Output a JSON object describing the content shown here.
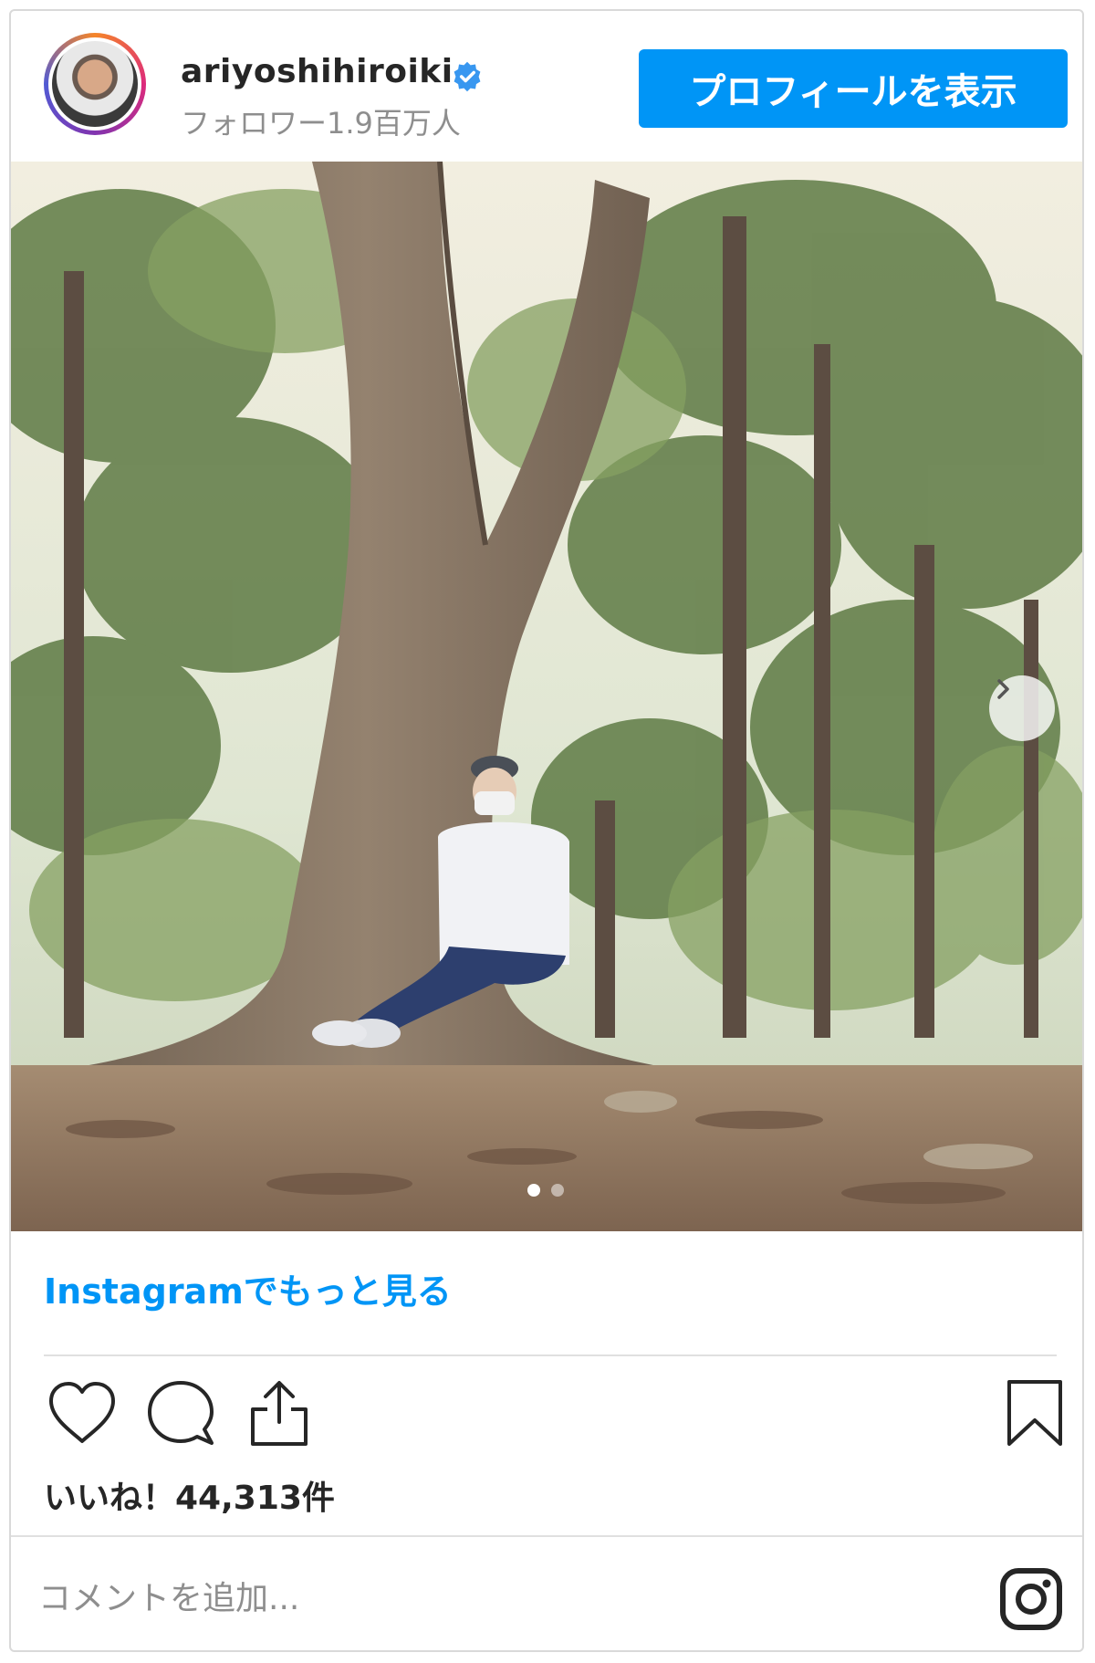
{
  "header": {
    "username": "ariyoshihiroiki",
    "followers": "フォロワー1.9百万人",
    "profile_button": "プロフィールを表示"
  },
  "photo": {
    "carousel_total": 2,
    "carousel_current": 1
  },
  "more_link": "Instagramでもっと見る",
  "likes": "いいね！44,313件",
  "comment": {
    "placeholder": "コメントを追加..."
  },
  "icons": {
    "verified": "verified-badge-icon",
    "like": "heart-icon",
    "comment": "comment-bubble-icon",
    "share": "share-icon",
    "save": "bookmark-icon",
    "next": "chevron-right-icon",
    "instagram": "instagram-logo-icon"
  },
  "colors": {
    "accent": "#0095f6",
    "text": "#262626",
    "muted": "#8e8e8e"
  }
}
